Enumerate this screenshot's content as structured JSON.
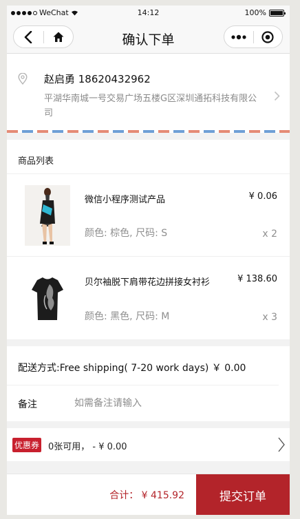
{
  "status_bar": {
    "carrier": "WeChat",
    "time": "14:12",
    "battery": "100%"
  },
  "nav": {
    "title": "确认下单",
    "back_icon": "chevron-left-icon",
    "home_icon": "home-icon",
    "more_icon": "more-dots-icon",
    "close_icon": "target-close-icon"
  },
  "address": {
    "name_phone": "赵启勇 18620432962",
    "detail": "平湖华南城一号交易广场五楼G区深圳通拓科技有限公司",
    "pin_icon": "location-pin-icon",
    "arrow_icon": "chevron-right-icon"
  },
  "goods": {
    "header": "商品列表",
    "items": [
      {
        "name": "微信小程序测试产品",
        "price": "¥ 0.06",
        "spec": "颜色: 棕色, 尺码: S",
        "qty": "x 2",
        "image": "dress-photo"
      },
      {
        "name": "贝尔袖脱下肩带花边拼接女衬衫",
        "price": "¥ 138.60",
        "spec": "颜色: 黑色, 尺码: M",
        "qty": "x 3",
        "image": "tshirt-photo"
      }
    ]
  },
  "shipping": {
    "text": "配送方式:Free shipping( 7-20 work days) ￥ 0.00"
  },
  "remark": {
    "label": "备注",
    "placeholder": "如需备注请输入"
  },
  "coupon": {
    "badge": "优惠券",
    "text": "0张可用，  - ¥ 0.00"
  },
  "footer": {
    "total": "合计： ¥ 415.92",
    "submit": "提交订单"
  },
  "colors": {
    "accent": "#b3242a",
    "coupon_badge": "#c8202e",
    "muted_text": "#8e8e8e"
  }
}
